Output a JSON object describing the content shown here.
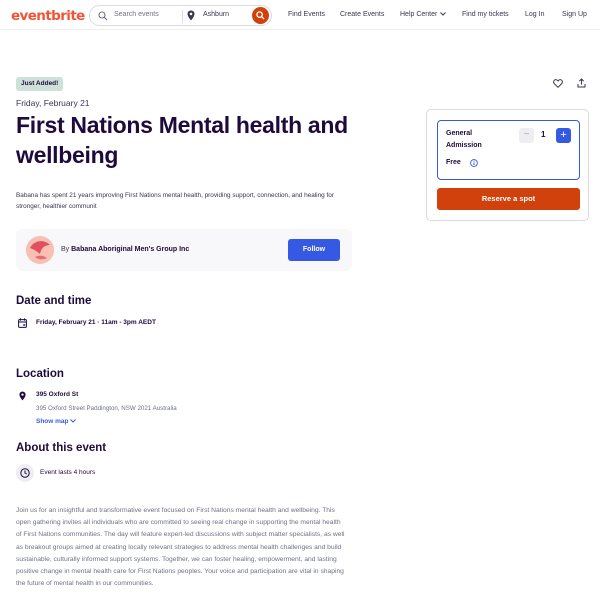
{
  "header": {
    "logo": "eventbrite",
    "search_placeholder": "Search events",
    "location": "Ashburn",
    "nav": [
      "Find Events",
      "Create Events",
      "Help Center",
      "Find my tickets",
      "Log In",
      "Sign Up"
    ]
  },
  "event": {
    "badge": "Just Added!",
    "date": "Friday, February 21",
    "title": "First Nations Mental health and wellbeing",
    "summary": "Babana has spent 21 years improving First Nations mental health, providing support, connection, and healing for stronger, healthier communit"
  },
  "organizer": {
    "by": "By",
    "name": "Babana Aboriginal Men's Group Inc",
    "follow_label": "Follow"
  },
  "date_time": {
    "heading": "Date and time",
    "value": "Friday, February 21 · 11am - 3pm AEDT"
  },
  "location": {
    "heading": "Location",
    "name": "395 Oxford St",
    "address": "395 Oxford Street Paddington, NSW 2021 Australia",
    "show_map": "Show map"
  },
  "about": {
    "heading": "About this event",
    "duration": "Event lasts 4 hours",
    "description": "Join us for an insightful and transformative event focused on First Nations mental health and wellbeing. This open gathering invites all individuals who are committed to seeing real change in supporting the mental health of First Nations communities. The day will feature expert-led discussions with subject matter specialists, as well as breakout groups aimed at creating locally relevant strategies to address mental health challenges and build sustainable, culturally informed support systems. Together, we can foster healing, empowerment, and lasting positive change in mental health care for First Nations peoples. Your voice and participation are vital in shaping the future of mental health in our communities."
  },
  "ticket": {
    "name": "General Admission",
    "price": "Free",
    "minus": "−",
    "quantity": "1",
    "plus": "+",
    "reserve_label": "Reserve a spot"
  },
  "colors": {
    "brand": "#f05537",
    "primary_blue": "#3659e3",
    "reserve_orange": "#d1410c",
    "badge_green": "#cde1d8"
  },
  "icons": [
    "search-icon",
    "location-pin-icon",
    "chevron-down-icon",
    "heart-icon",
    "share-icon",
    "calendar-icon",
    "clock-icon",
    "info-icon"
  ]
}
